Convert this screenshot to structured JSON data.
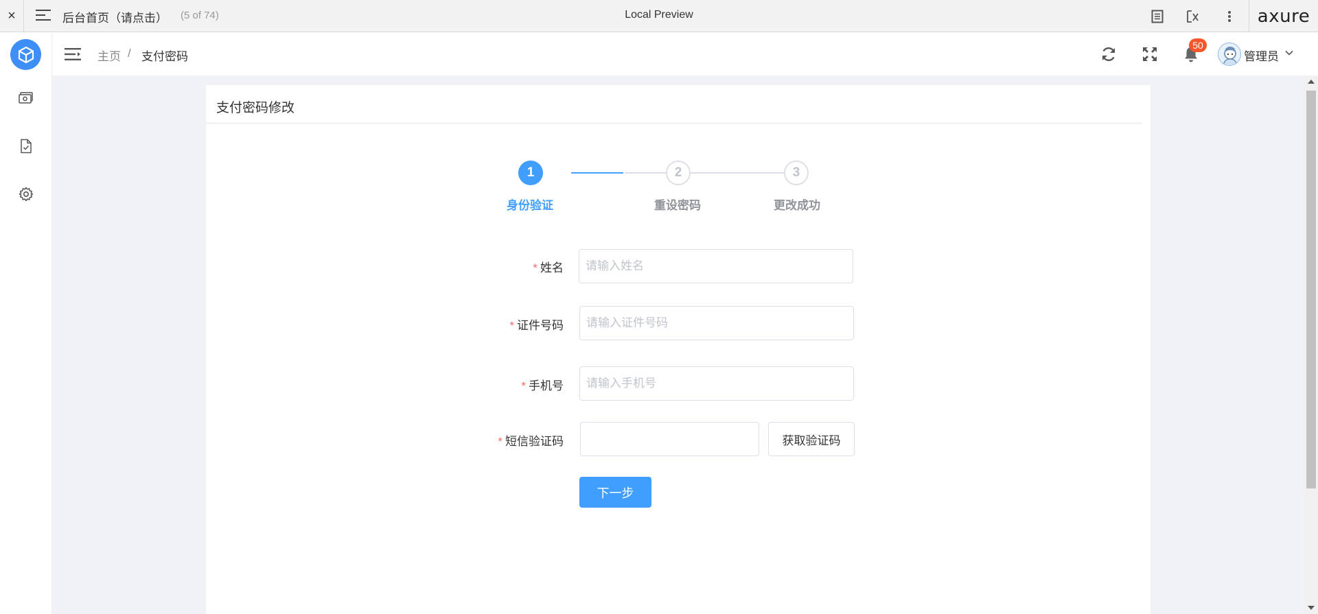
{
  "axure_bar": {
    "close": "×",
    "page_name": "后台首页（请点击）",
    "page_count": "(5 of 74)",
    "title": "Local Preview",
    "logo": "axure"
  },
  "sidebar": {
    "items": [
      {
        "icon": "money-icon"
      },
      {
        "icon": "document-check-icon"
      },
      {
        "icon": "gear-icon"
      }
    ]
  },
  "header": {
    "breadcrumb": {
      "home": "主页",
      "separator": "/",
      "current": "支付密码"
    },
    "notification_count": "50",
    "user_name": "管理员"
  },
  "card": {
    "title": "支付密码修改",
    "steps": [
      {
        "number": "1",
        "label": "身份验证",
        "status": "active"
      },
      {
        "number": "2",
        "label": "重设密码",
        "status": "wait"
      },
      {
        "number": "3",
        "label": "更改成功",
        "status": "wait"
      }
    ],
    "form": {
      "required_mark": "*",
      "name_label": "姓名",
      "name_placeholder": "请输入姓名",
      "id_label": "证件号码",
      "id_placeholder": "请输入证件号码",
      "phone_label": "手机号",
      "phone_placeholder": "请输入手机号",
      "sms_label": "短信验证码",
      "sms_value": "",
      "get_code_label": "获取验证码",
      "next_label": "下一步"
    }
  },
  "colors": {
    "accent": "#409eff",
    "logo": "#3e8ef7",
    "badge": "#f5562b",
    "required": "#f56c6c",
    "background": "#f0f2f5"
  }
}
